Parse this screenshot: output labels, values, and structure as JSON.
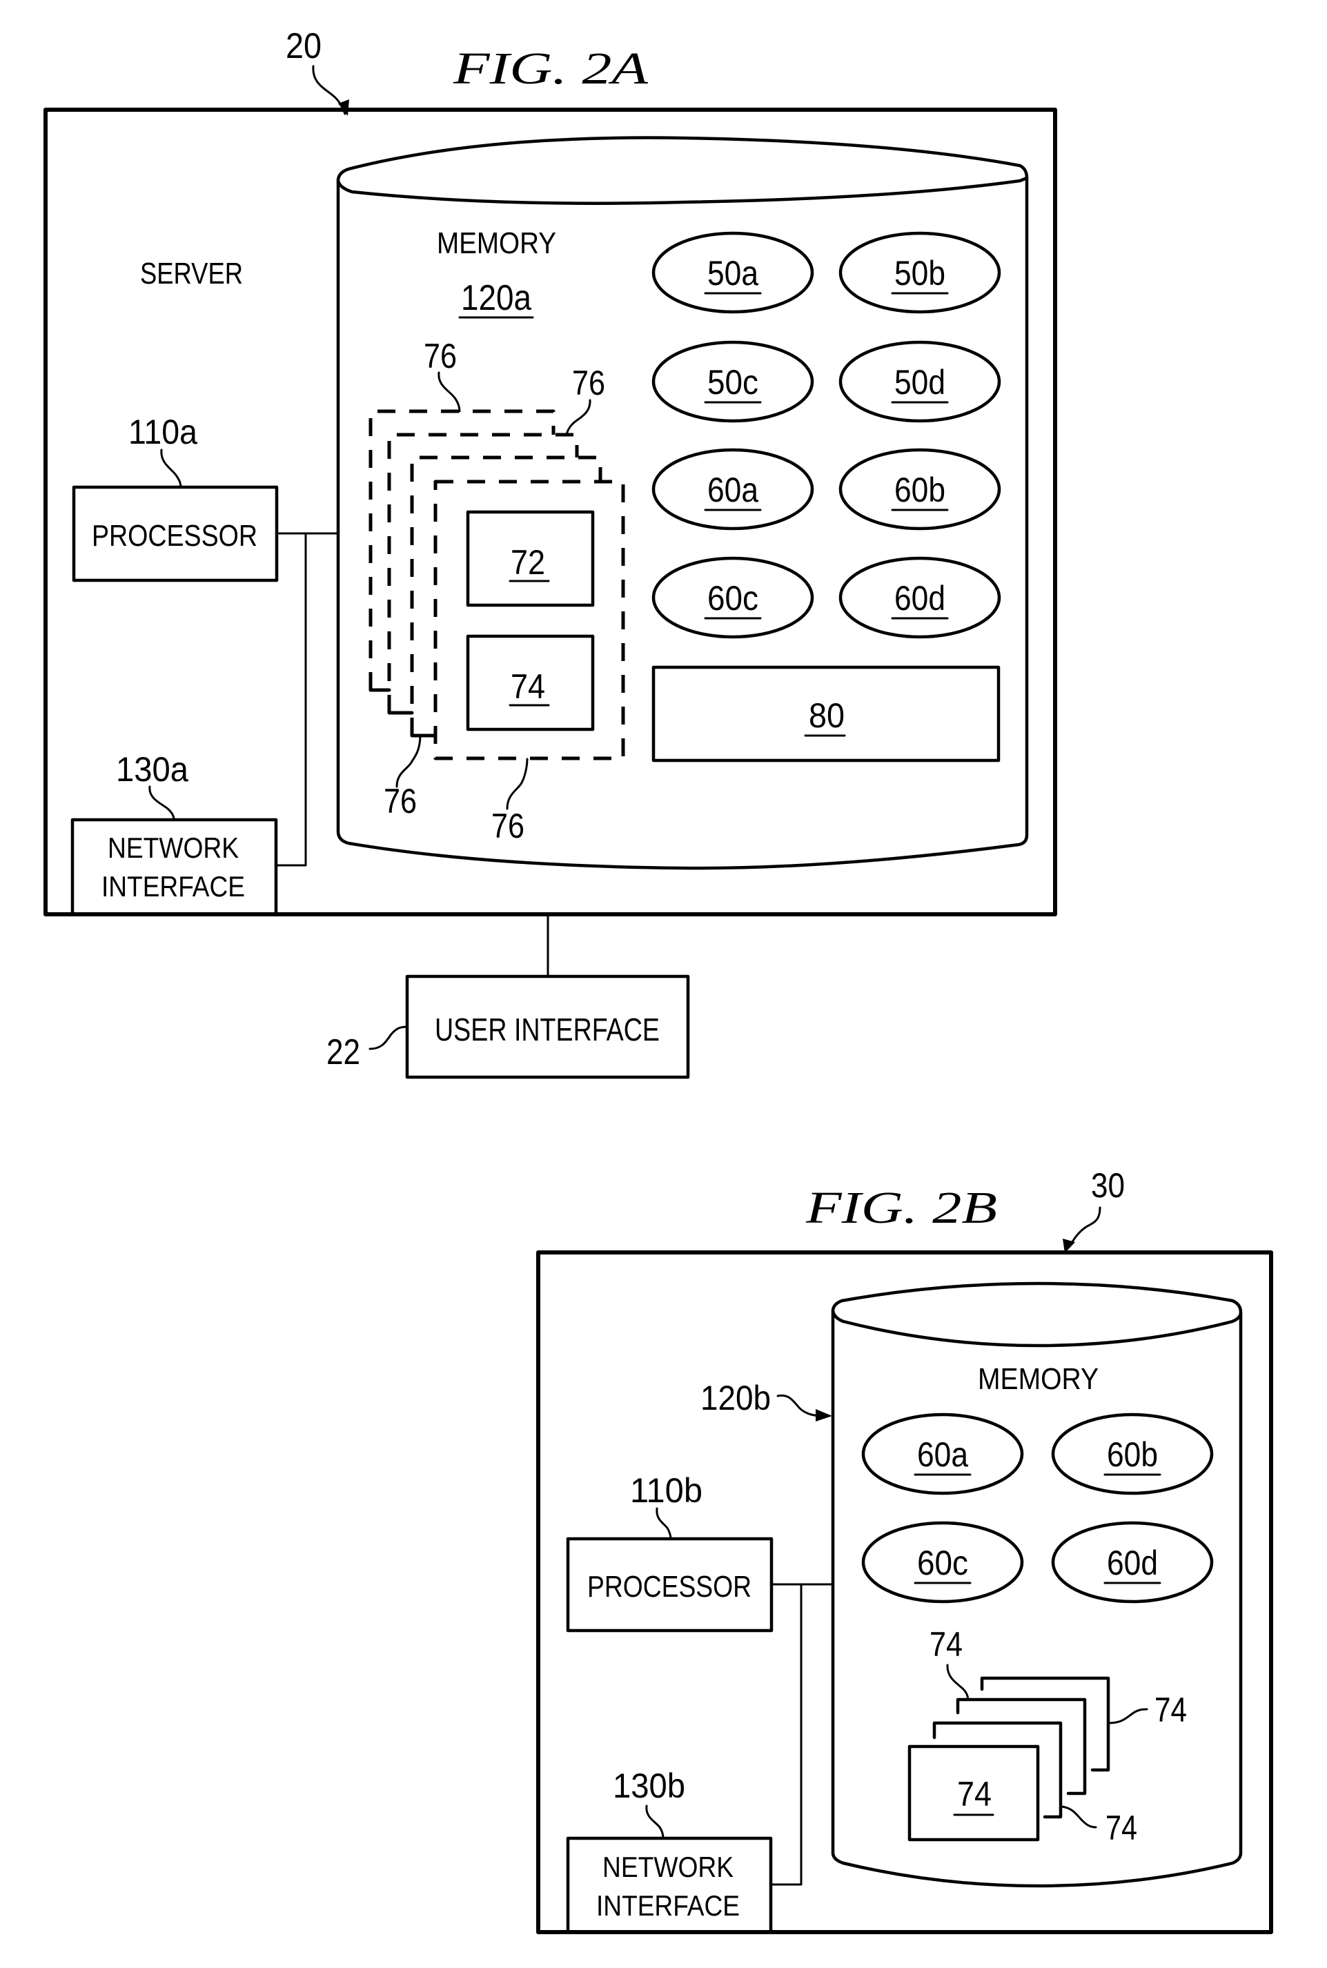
{
  "fig2a": {
    "title": "FIG. 2A",
    "ref_server": "20",
    "server_label": "SERVER",
    "memory_label": "MEMORY",
    "memory_ref": "120a",
    "processor_ref": "110a",
    "processor_label": "PROCESSOR",
    "network_ref": "130a",
    "network_label_line1": "NETWORK",
    "network_label_line2": "INTERFACE",
    "ovals": [
      "50a",
      "50b",
      "50c",
      "50d",
      "60a",
      "60b",
      "60c",
      "60d"
    ],
    "box_72": "72",
    "box_74": "74",
    "box_80": "80",
    "stack_refs": [
      "76",
      "76",
      "76",
      "76"
    ],
    "user_interface_ref": "22",
    "user_interface_label": "USER INTERFACE"
  },
  "fig2b": {
    "title": "FIG. 2B",
    "ref_server": "30",
    "memory_label": "MEMORY",
    "memory_ref": "120b",
    "processor_ref": "110b",
    "processor_label": "PROCESSOR",
    "network_ref": "130b",
    "network_label_line1": "NETWORK",
    "network_label_line2": "INTERFACE",
    "ovals": [
      "60a",
      "60b",
      "60c",
      "60d"
    ],
    "box_74": "74",
    "stack_refs": [
      "74",
      "74",
      "74"
    ]
  }
}
